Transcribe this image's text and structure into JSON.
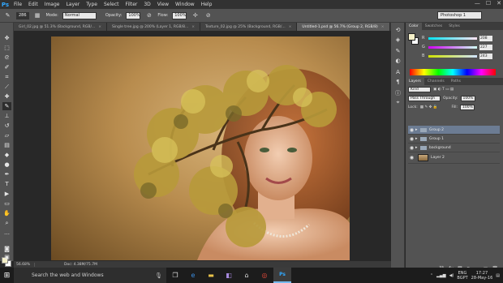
{
  "app": {
    "logo": "Ps"
  },
  "menubar": {
    "items": [
      "File",
      "Edit",
      "Image",
      "Layer",
      "Type",
      "Select",
      "Filter",
      "3D",
      "View",
      "Window",
      "Help"
    ],
    "window_controls": [
      "—",
      "☐",
      "✕"
    ]
  },
  "options": {
    "brush_size": "286",
    "mode_label": "Mode:",
    "mode_value": "Normal",
    "opacity_label": "Opacity:",
    "opacity_value": "100%",
    "flow_label": "Flow:",
    "flow_value": "100%",
    "workspace": "Photoshop 1"
  },
  "tabs": [
    {
      "label": "Girl_02.jpg @ 51.3% (Background, RGB/...",
      "active": false
    },
    {
      "label": "Single tree.jpg @ 200% (Layer 1, RGB/8...",
      "active": false
    },
    {
      "label": "Texture_02.jpg @ 25% (Background, RGB/...",
      "active": false
    },
    {
      "label": "Untitled-1.psd @ 56.7% (Group 2, RGB/8)",
      "active": true
    }
  ],
  "status": {
    "zoom": "56.68%",
    "doc": "Doc: 4.38M/75.7M"
  },
  "color_panel": {
    "tabs": [
      "Color",
      "Swatches",
      "Styles"
    ],
    "r_label": "R",
    "r_value": "208",
    "g_label": "G",
    "g_value": "227",
    "b_label": "B",
    "b_value": "243"
  },
  "layers_panel": {
    "tabs": [
      "Layers",
      "Channels",
      "Paths"
    ],
    "kind_label": "Kind",
    "blend_mode": "Pass Through",
    "opacity_label": "Opacity:",
    "opacity_value": "100%",
    "lock_label": "Lock:",
    "fill_label": "Fill:",
    "fill_value": "100%",
    "layers": [
      {
        "name": "Group 2",
        "type": "group",
        "selected": true
      },
      {
        "name": "Group 1",
        "type": "group",
        "selected": false
      },
      {
        "name": "background",
        "type": "group",
        "selected": false
      },
      {
        "name": "Layer 2",
        "type": "layer",
        "selected": false
      }
    ]
  },
  "taskbar": {
    "search_placeholder": "Search the web and Windows",
    "language": "ENG",
    "region": "BGPT",
    "time": "17:27",
    "date": "28-May-16"
  },
  "colors": {
    "accent": "#31a8ff",
    "selected_layer": "#6c7c93",
    "fg_color": "#f5f0c8"
  }
}
